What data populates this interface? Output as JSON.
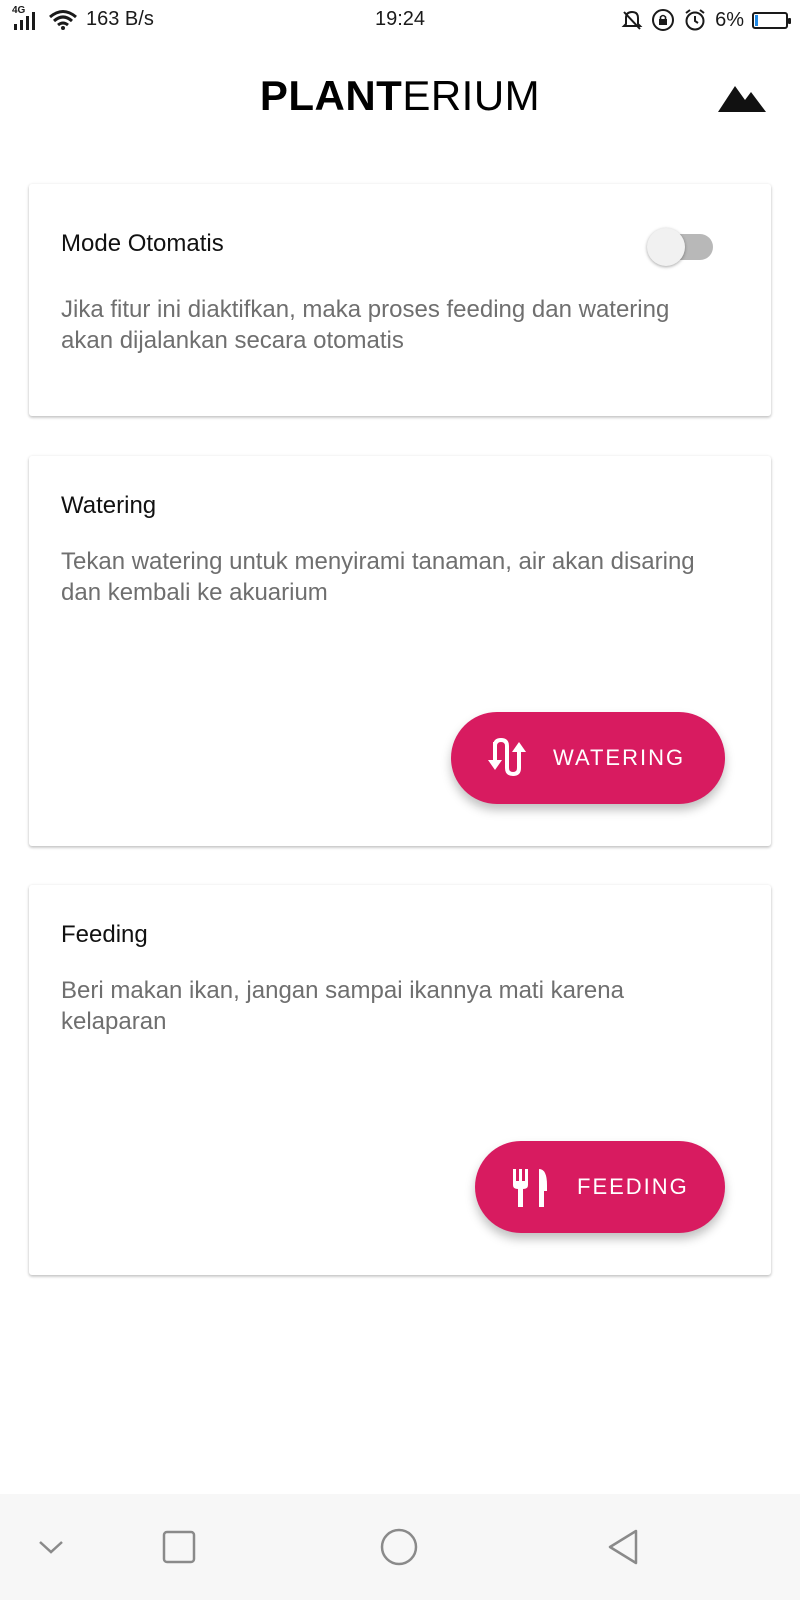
{
  "status_bar": {
    "network_label": "4G",
    "speed": "163 B/s",
    "time": "19:24",
    "battery": "6%",
    "accent": "#1e88e5"
  },
  "app_bar": {
    "title_bold": "PLANT",
    "title_light": "ERIUM",
    "action_icon": "landscape-icon"
  },
  "cards": {
    "auto": {
      "title": "Mode Otomatis",
      "description": "Jika fitur ini diaktifkan, maka proses feeding dan watering akan dijalankan secara otomatis",
      "toggle_on": false
    },
    "watering": {
      "title": "Watering",
      "description": "Tekan watering untuk menyirami tanaman, air akan disaring dan kembali ke akuarium",
      "button_label": "WATERING",
      "button_icon": "swap-vertical-icon"
    },
    "feeding": {
      "title": "Feeding",
      "description": "Beri makan ikan, jangan sampai ikannya mati karena kelaparan",
      "button_label": "FEEDING",
      "button_icon": "fork-knife-icon"
    }
  },
  "colors": {
    "accent": "#d81b60",
    "toggle_track": "#b8b8b8",
    "description_text": "#6f6f6f"
  },
  "nav_bar": {
    "items": [
      "collapse-icon",
      "recents-icon",
      "home-icon",
      "back-icon"
    ]
  }
}
